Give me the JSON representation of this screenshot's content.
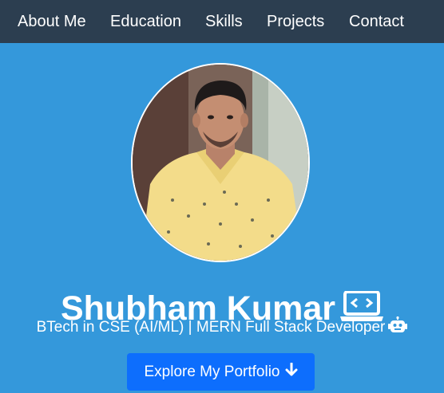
{
  "nav": {
    "items": [
      {
        "label": "About Me"
      },
      {
        "label": "Education"
      },
      {
        "label": "Skills"
      },
      {
        "label": "Projects"
      },
      {
        "label": "Contact"
      }
    ]
  },
  "hero": {
    "name": "Shubham Kumar",
    "name_icon": "laptop-code-icon",
    "subtitle": "BTech in CSE (AI/ML) | MERN Full Stack Developer",
    "subtitle_icon": "robot-icon",
    "cta_label": "Explore My Portfolio",
    "cta_icon": "arrow-down-icon"
  },
  "colors": {
    "nav_bg": "#2c3e50",
    "page_bg": "#3498db",
    "button_bg": "#0d6efd",
    "text": "#ffffff"
  }
}
